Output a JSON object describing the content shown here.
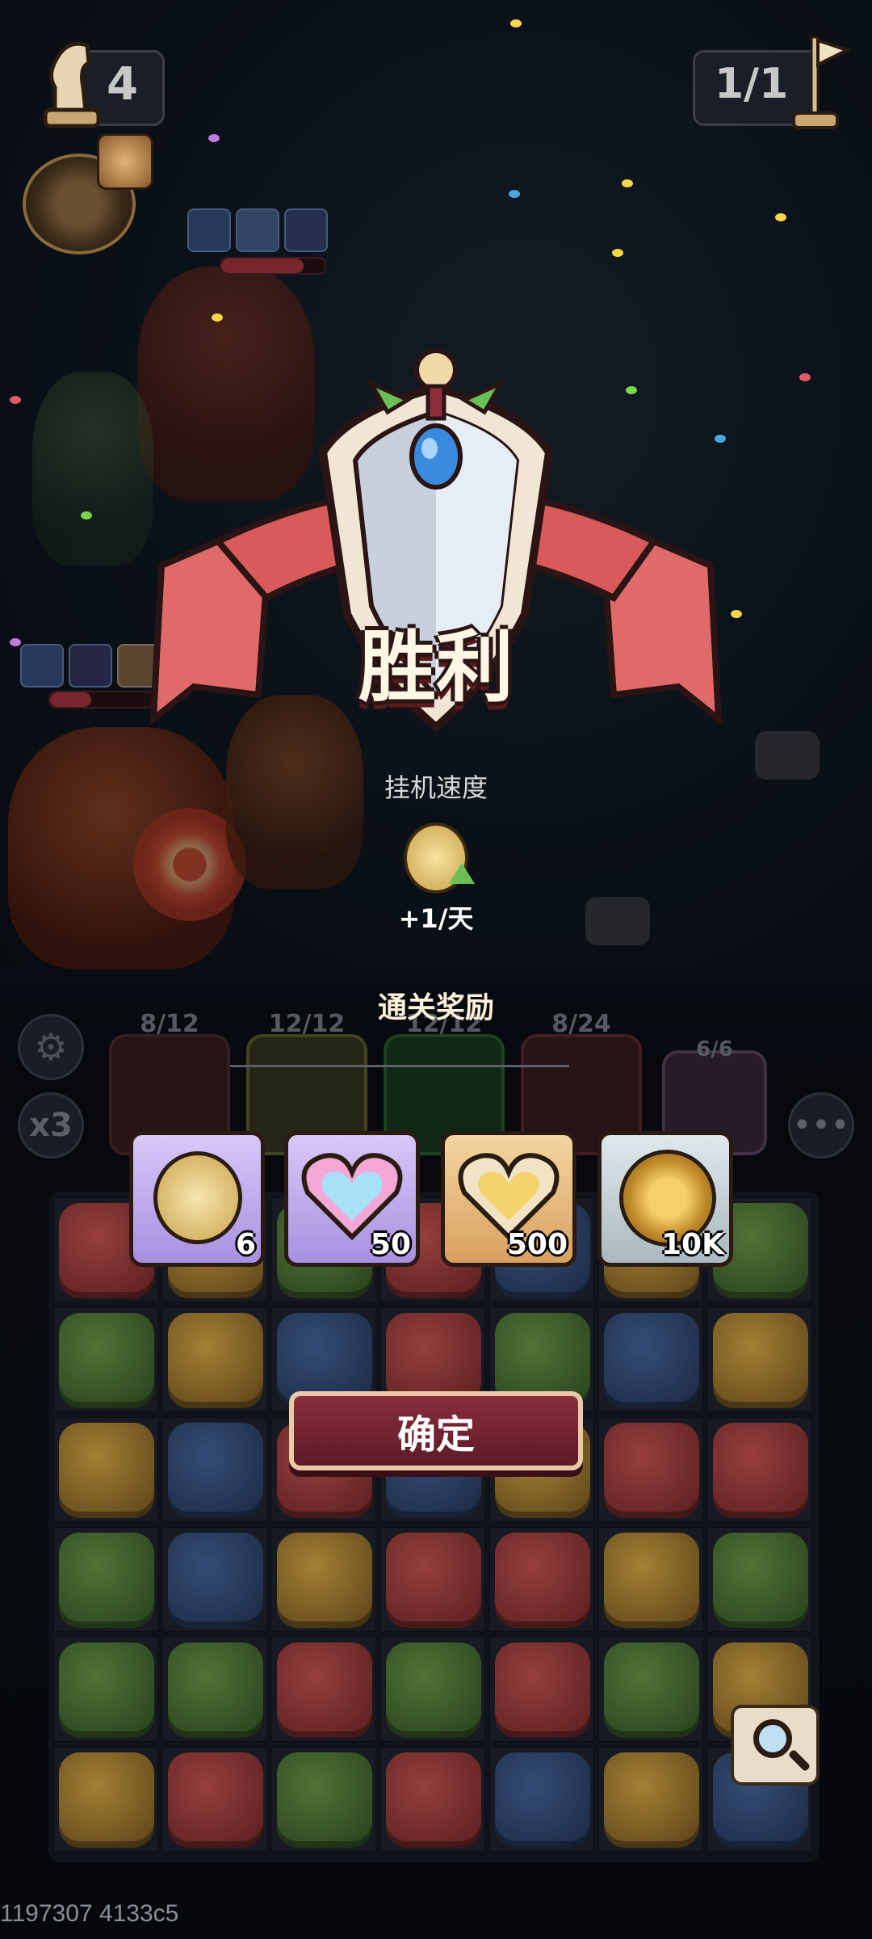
{
  "hud": {
    "moves_left": "4",
    "stage_progress": "1/1"
  },
  "victory": {
    "title": "胜利",
    "subtitle": "挂机速度",
    "speed_bonus": "+1/天"
  },
  "rewards": {
    "header": "通关奖励",
    "items": [
      {
        "icon": "gold-crystal-coin-icon",
        "qty": "6",
        "frame": "#c9b8f0"
      },
      {
        "icon": "rainbow-heart-icon",
        "qty": "50",
        "frame": "#c9b8f0"
      },
      {
        "icon": "gold-heart-icon",
        "qty": "500",
        "frame": "#e3b272"
      },
      {
        "icon": "gold-coin-icon",
        "qty": "10K",
        "frame": "#c9d3d8"
      }
    ]
  },
  "team": {
    "slots": [
      "8/12",
      "12/12",
      "12/12",
      "8/24",
      "6/6"
    ]
  },
  "side": {
    "speed_label": "x3"
  },
  "buttons": {
    "confirm_label": "确定"
  },
  "build_info": "1197307 4133c5",
  "colors": {
    "accent_red": "#8a2e3c",
    "banner_red": "#e06a6a",
    "gold": "#f4d36b"
  }
}
